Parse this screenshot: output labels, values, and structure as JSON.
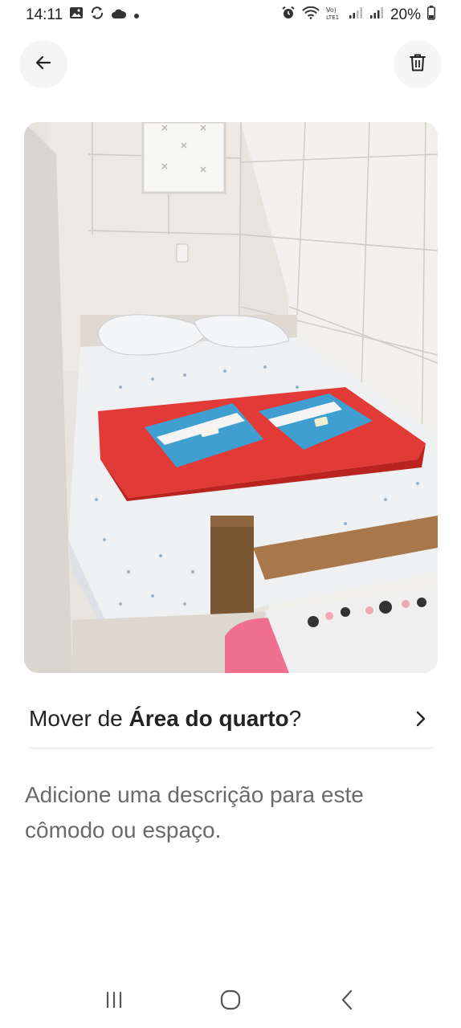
{
  "status_bar": {
    "time": "14:11",
    "battery_percent": "20%",
    "icons_left": [
      "gallery-icon",
      "sync-icon",
      "cloud-icon",
      "dot-icon"
    ],
    "icons_right": [
      "alarm-icon",
      "wifi-icon",
      "volte-icon",
      "signal-icon",
      "signal-icon",
      "battery-icon"
    ]
  },
  "top_bar": {
    "back_icon": "arrow-left-icon",
    "delete_icon": "trash-icon"
  },
  "photo": {
    "description_icon": "bedroom-photo"
  },
  "move_row": {
    "prefix": "Mover de ",
    "room_name": "Área do quarto",
    "suffix": "?",
    "chevron_icon": "chevron-right-icon"
  },
  "description": {
    "placeholder": "Adicione uma descrição para este cômodo ou espaço."
  },
  "nav_bar": {
    "recent_icon": "recent-apps-icon",
    "home_icon": "home-icon",
    "back_icon": "back-icon"
  },
  "colors": {
    "text_primary": "#222222",
    "text_secondary": "#6a6a6a",
    "button_bg": "#f5f5f5",
    "divider": "#e6e6e6"
  }
}
